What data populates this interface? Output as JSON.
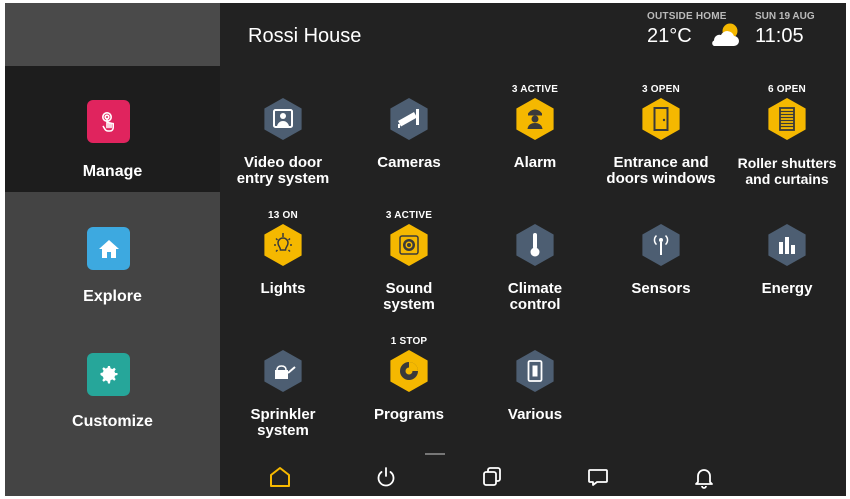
{
  "header": {
    "title": "Rossi House",
    "outside_label": "OUTSIDE HOME",
    "temperature": "21°C",
    "weather_icon": "partly-cloudy-icon",
    "date": "SUN 19 AUG",
    "time": "11:05"
  },
  "sidebar": {
    "items": [
      {
        "label": "Manage",
        "icon": "touch-icon",
        "color": "#e0245e",
        "active": true
      },
      {
        "label": "Explore",
        "icon": "home-icon",
        "color": "#3da9e0",
        "active": false
      },
      {
        "label": "Customize",
        "icon": "gear-icon",
        "color": "#26a69a",
        "active": false
      }
    ]
  },
  "grid": {
    "accent_color": "#f5b800",
    "inactive_color": "#4d5e72",
    "tiles": [
      {
        "label": "Video door entry system",
        "line1": "Video door",
        "line2": "entry system",
        "badge": "",
        "icon": "video-door-icon",
        "active": false
      },
      {
        "label": "Cameras",
        "line1": "Cameras",
        "line2": "",
        "badge": "",
        "icon": "camera-icon",
        "active": false
      },
      {
        "label": "Alarm",
        "line1": "Alarm",
        "line2": "",
        "badge": "3 ACTIVE",
        "icon": "guard-icon",
        "active": true
      },
      {
        "label": "Entrance and doors windows",
        "line1": "Entrance and",
        "line2": "doors windows",
        "badge": "3 OPEN",
        "icon": "door-icon",
        "active": true
      },
      {
        "label": "Roller shutters and curtains",
        "line1": "Roller shutters",
        "line2": "and curtains",
        "badge": "6 OPEN",
        "icon": "shutter-icon",
        "active": true
      },
      {
        "label": "Lights",
        "line1": "Lights",
        "line2": "",
        "badge": "13 ON",
        "icon": "bulb-icon",
        "active": true
      },
      {
        "label": "Sound system",
        "line1": "Sound",
        "line2": "system",
        "badge": "3 ACTIVE",
        "icon": "speaker-icon",
        "active": true
      },
      {
        "label": "Climate control",
        "line1": "Climate",
        "line2": "control",
        "badge": "",
        "icon": "thermometer-icon",
        "active": false
      },
      {
        "label": "Sensors",
        "line1": "Sensors",
        "line2": "",
        "badge": "",
        "icon": "sensor-icon",
        "active": false
      },
      {
        "label": "Energy",
        "line1": "Energy",
        "line2": "",
        "badge": "",
        "icon": "energy-icon",
        "active": false
      },
      {
        "label": "Sprinkler system",
        "line1": "Sprinkler",
        "line2": "system",
        "badge": "",
        "icon": "watering-can-icon",
        "active": false
      },
      {
        "label": "Programs",
        "line1": "Programs",
        "line2": "",
        "badge": "1 STOP",
        "icon": "programs-icon",
        "active": true
      },
      {
        "label": "Various",
        "line1": "Various",
        "line2": "",
        "badge": "",
        "icon": "switch-icon",
        "active": false
      }
    ]
  },
  "bottom_bar": {
    "items": [
      {
        "icon": "home-outline-icon",
        "active": true
      },
      {
        "icon": "power-icon",
        "active": false
      },
      {
        "icon": "multitask-icon",
        "active": false
      },
      {
        "icon": "message-icon",
        "active": false
      },
      {
        "icon": "bell-icon",
        "active": false
      }
    ]
  }
}
